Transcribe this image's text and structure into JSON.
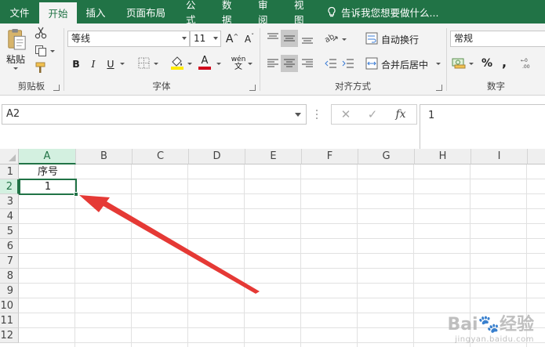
{
  "ribbon_tabs": [
    {
      "label": "文件",
      "active": false
    },
    {
      "label": "开始",
      "active": true
    },
    {
      "label": "插入",
      "active": false
    },
    {
      "label": "页面布局",
      "active": false
    },
    {
      "label": "公式",
      "active": false
    },
    {
      "label": "数据",
      "active": false
    },
    {
      "label": "审阅",
      "active": false
    },
    {
      "label": "视图",
      "active": false
    }
  ],
  "tell_me": "告诉我您想要做什么...",
  "clipboard": {
    "paste_label": "粘贴",
    "group_label": "剪贴板"
  },
  "font": {
    "name": "等线",
    "size": "11",
    "bold": "B",
    "italic": "I",
    "underline": "U",
    "group_label": "字体",
    "grow": "A",
    "shrink": "A",
    "font_color_letter": "A",
    "phonetic": "wén"
  },
  "alignment": {
    "wrap_label": "自动换行",
    "merge_label": "合并后居中",
    "group_label": "对齐方式"
  },
  "number": {
    "format": "常规",
    "percent": "%",
    "comma": ",",
    "group_label": "数字"
  },
  "formula_bar": {
    "name_box": "A2",
    "content": "1",
    "fx": "fx"
  },
  "columns": [
    "A",
    "B",
    "C",
    "D",
    "E",
    "F",
    "G",
    "H",
    "I"
  ],
  "rows": [
    "1",
    "2",
    "3",
    "4",
    "5",
    "6",
    "7",
    "8",
    "9",
    "10",
    "11",
    "12"
  ],
  "cells": {
    "A1": "序号",
    "A2": "1"
  },
  "watermark": {
    "main": "Bai🐾经验",
    "sub": "jingyan.baidu.com"
  },
  "colors": {
    "accent": "#217346",
    "arrow": "#e53935"
  }
}
